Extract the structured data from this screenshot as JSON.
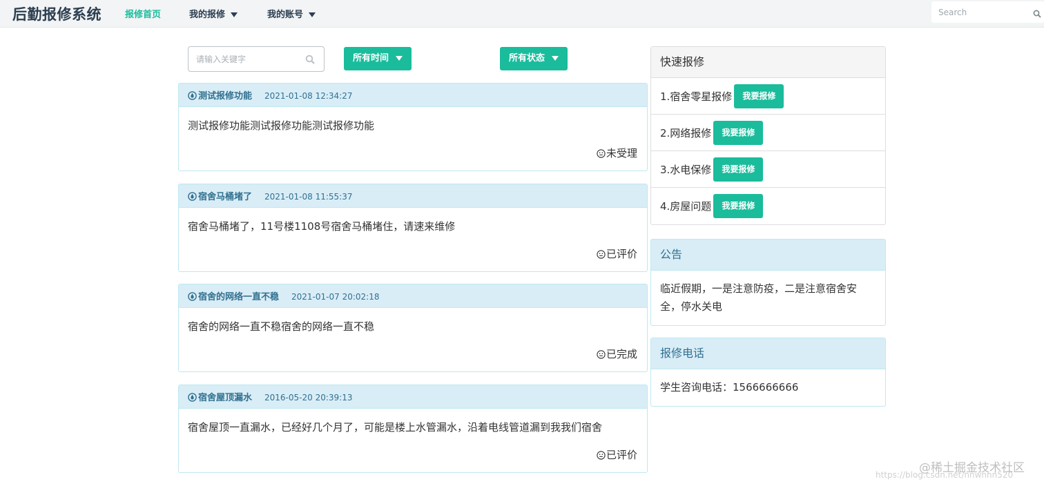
{
  "navbar": {
    "brand": "后勤报修系统",
    "links": [
      {
        "label": "报修首页",
        "active": true
      },
      {
        "label": "我的报修",
        "dropdown": true
      },
      {
        "label": "我的账号",
        "dropdown": true
      }
    ],
    "search_placeholder": "Search"
  },
  "filters": {
    "keyword_placeholder": "请输入关键字",
    "time_label": "所有时间",
    "status_label": "所有状态"
  },
  "repairs": [
    {
      "title": "测试报修功能",
      "time": "2021-01-08 12:34:27",
      "content": "测试报修功能测试报修功能测试报修功能",
      "status": "未受理"
    },
    {
      "title": "宿舍马桶堵了",
      "time": "2021-01-08 11:55:37",
      "content": "宿舍马桶堵了，11号楼1108号宿舍马桶堵住，请速来维修",
      "status": "已评价"
    },
    {
      "title": "宿舍的网络一直不稳",
      "time": "2021-01-07 20:02:18",
      "content": "宿舍的网络一直不稳宿舍的网络一直不稳",
      "status": "已完成"
    },
    {
      "title": "宿舍屋顶漏水",
      "time": "2016-05-20 20:39:13",
      "content": "宿舍屋顶一直漏水，已经好几个月了，可能是楼上水管漏水，沿着电线管道漏到我我们宿舍",
      "status": "已评价"
    }
  ],
  "quick_repair": {
    "title": "快速报修",
    "button_label": "我要报修",
    "items": [
      "1.宿舍零星报修",
      "2.网络报修",
      "3.水电保修",
      "4.房屋问题"
    ]
  },
  "notice": {
    "title": "公告",
    "content": "临近假期，一是注意防疫，二是注意宿舍安全，停水关电"
  },
  "phone": {
    "title": "报修电话",
    "content": "学生咨询电话：1566666666"
  },
  "watermark": {
    "text": "@稀土掘金技术社区",
    "url": "https://blog.csdn.net/nnwnnn520"
  },
  "colors": {
    "accent": "#1abc9c",
    "brand_text": "#2c3e50",
    "info_bg": "#d9edf7",
    "info_border": "#bce8f1",
    "info_text": "#31708f"
  },
  "icons": {
    "nav_search": "search-icon",
    "keyword_search": "search-icon",
    "card_title": "water-drop-icon",
    "card_status": "smile-face-icon",
    "dropdown": "caret-down-icon"
  }
}
